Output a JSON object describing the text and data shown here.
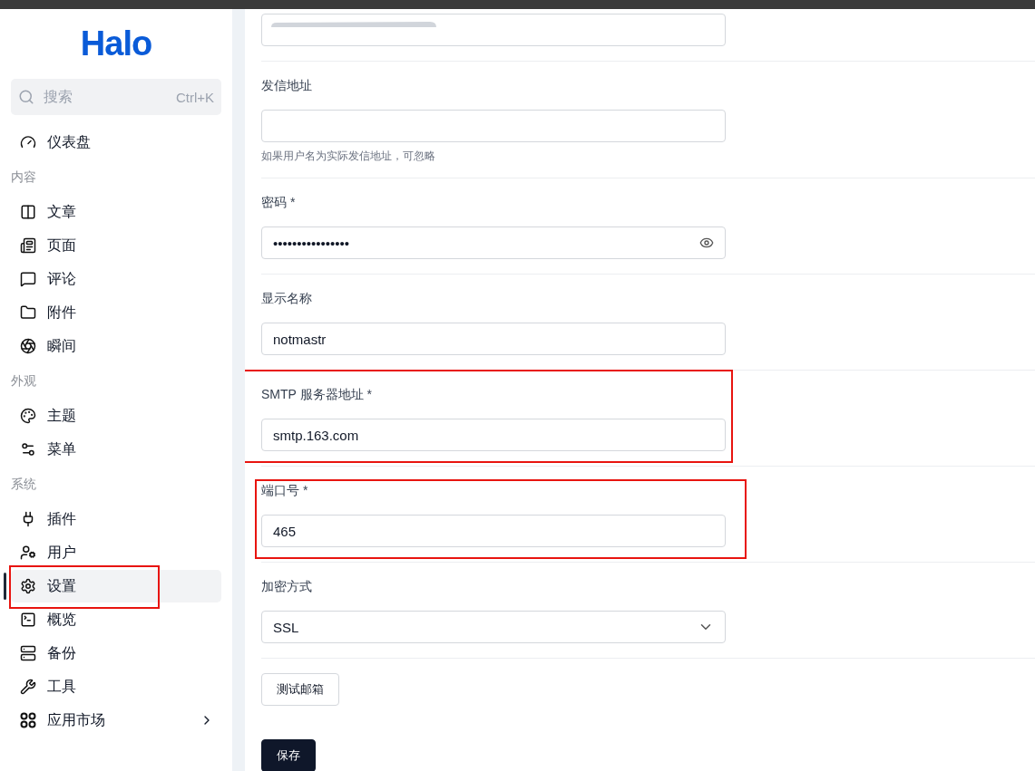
{
  "logo": "Halo",
  "search": {
    "placeholder": "搜索",
    "shortcut": "Ctrl+K"
  },
  "sidebar": {
    "items": [
      {
        "kind": "item",
        "label": "仪表盘",
        "selected": false,
        "highlighted": false,
        "submenu": false
      },
      {
        "kind": "heading",
        "label": "内容"
      },
      {
        "kind": "item",
        "label": "文章",
        "selected": false,
        "highlighted": false,
        "submenu": false
      },
      {
        "kind": "item",
        "label": "页面",
        "selected": false,
        "highlighted": false,
        "submenu": false
      },
      {
        "kind": "item",
        "label": "评论",
        "selected": false,
        "highlighted": false,
        "submenu": false
      },
      {
        "kind": "item",
        "label": "附件",
        "selected": false,
        "highlighted": false,
        "submenu": false
      },
      {
        "kind": "item",
        "label": "瞬间",
        "selected": false,
        "highlighted": false,
        "submenu": false
      },
      {
        "kind": "heading",
        "label": "外观"
      },
      {
        "kind": "item",
        "label": "主题",
        "selected": false,
        "highlighted": false,
        "submenu": false
      },
      {
        "kind": "item",
        "label": "菜单",
        "selected": false,
        "highlighted": false,
        "submenu": false
      },
      {
        "kind": "heading",
        "label": "系统"
      },
      {
        "kind": "item",
        "label": "插件",
        "selected": false,
        "highlighted": false,
        "submenu": false
      },
      {
        "kind": "item",
        "label": "用户",
        "selected": false,
        "highlighted": false,
        "submenu": false
      },
      {
        "kind": "item",
        "label": "设置",
        "selected": true,
        "highlighted": true,
        "submenu": false
      },
      {
        "kind": "item",
        "label": "概览",
        "selected": false,
        "highlighted": false,
        "submenu": false
      },
      {
        "kind": "item",
        "label": "备份",
        "selected": false,
        "highlighted": false,
        "submenu": false
      },
      {
        "kind": "item",
        "label": "工具",
        "selected": false,
        "highlighted": false,
        "submenu": false
      },
      {
        "kind": "item",
        "label": "应用市场",
        "selected": false,
        "highlighted": false,
        "submenu": true
      }
    ]
  },
  "form": {
    "fields": [
      {
        "kind": "redacted",
        "highlighted": false
      },
      {
        "kind": "text",
        "label": "发信地址",
        "help": "如果用户名为实际发信地址，可忽略",
        "highlighted": false
      },
      {
        "kind": "password",
        "label": "密码 *",
        "value": "••••••••••••••••",
        "highlighted": false
      },
      {
        "kind": "text",
        "label": "显示名称",
        "value": "notmastr",
        "highlighted": false
      },
      {
        "kind": "text",
        "label": "SMTP 服务器地址 *",
        "value": "smtp.163.com",
        "highlighted": true
      },
      {
        "kind": "text",
        "label": "端口号 *",
        "value": "465",
        "highlighted": true
      },
      {
        "kind": "select",
        "label": "加密方式",
        "value": "SSL",
        "highlighted": false
      }
    ],
    "actions": [
      {
        "kind": "secondary",
        "label": "测试邮箱"
      },
      {
        "kind": "primary",
        "label": "保存"
      }
    ]
  }
}
